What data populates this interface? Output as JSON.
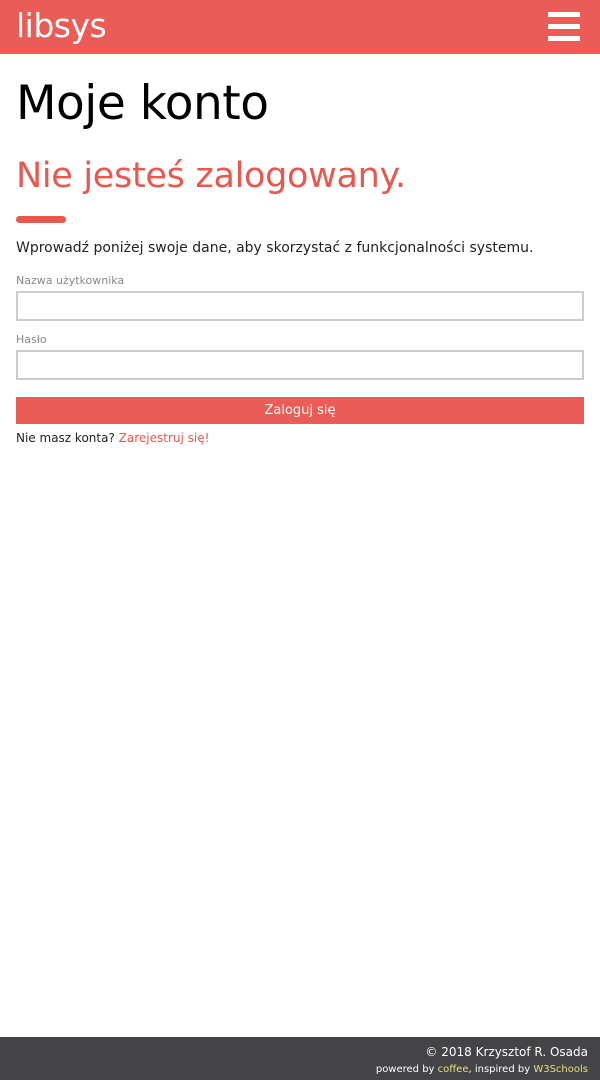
{
  "header": {
    "logo_text": "libsys",
    "menu_icon": "hamburger-menu-icon",
    "bg_color": "#ec5c57"
  },
  "main": {
    "title": "Moje konto",
    "status_heading": "Nie jesteś zalogowany.",
    "intro_text": "Wprowadź poniżej swoje dane, aby skorzystać z funkcjonalności systemu.",
    "form": {
      "username_label": "Nazwa użytkownika",
      "username_value": "",
      "password_label": "Hasło",
      "password_value": "",
      "submit_label": "Zaloguj się"
    },
    "register": {
      "prompt": "Nie masz konta?",
      "link_text": "Zarejestruj się!"
    },
    "accent_color": "#e8584f"
  },
  "footer": {
    "copyright": "© 2018 Krzysztof R. Osada",
    "powered_by_prefix": "powered by",
    "powered_by_link": "coffee",
    "inspired_by_prefix": ", inspired by",
    "inspired_by_link": "W3Schools",
    "bg_color": "#444447",
    "link_color": "#e6e07a"
  }
}
